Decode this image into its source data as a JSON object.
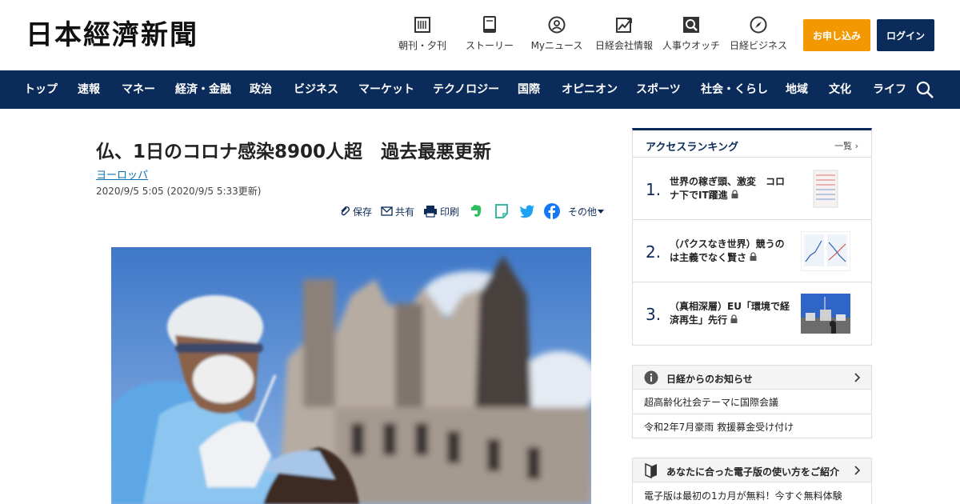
{
  "header": {
    "logo": "日本經濟新聞",
    "utility": [
      {
        "label": "朝刊・夕刊",
        "icon": "newspaper-icon"
      },
      {
        "label": "ストーリー",
        "icon": "book-icon"
      },
      {
        "label": "Myニュース",
        "icon": "person-icon"
      },
      {
        "label": "日経会社情報",
        "icon": "chart-icon"
      },
      {
        "label": "人事ウオッチ",
        "icon": "magnifier-icon"
      },
      {
        "label": "日経ビジネス",
        "icon": "compass-icon"
      }
    ],
    "apply_label": "お申し込み",
    "login_label": "ログイン"
  },
  "nav": {
    "items": [
      "トップ",
      "速報",
      "マネー",
      "経済・金融",
      "政治",
      "ビジネス",
      "マーケット",
      "テクノロジー",
      "国際",
      "オピニオン",
      "スポーツ",
      "社会・くらし",
      "地域",
      "文化",
      "ライフ"
    ]
  },
  "article": {
    "title": "仏、1日のコロナ感染8900人超　過去最悪更新",
    "category": "ヨーロッパ",
    "date": "2020/9/5 5:05 (2020/9/5 5:33更新)",
    "share": {
      "save": "保存",
      "share": "共有",
      "print": "印刷",
      "other": "その他"
    }
  },
  "ranking": {
    "title": "アクセスランキング",
    "more": "一覧",
    "items": [
      {
        "num": "1.",
        "text": "世界の稼ぎ頭、激変　コロナ下でIT躍進"
      },
      {
        "num": "2.",
        "text": "（パクスなき世界）競うのは主義でなく賢さ"
      },
      {
        "num": "3.",
        "text": "（真相深層）EU「環境で経済再生」先行"
      }
    ]
  },
  "notice": {
    "title": "日経からのお知らせ",
    "links": [
      "超高齢化社会テーマに国際会議",
      "令和2年7月豪雨 救援募金受け付け"
    ]
  },
  "guide": {
    "title": "あなたに合った電子版の使い方をご紹介",
    "text": "電子版は最初の1カ月が無料！今すぐ無料体験"
  },
  "colors": {
    "navy": "#0b2b5a",
    "orange": "#f39800",
    "link": "#0b6fb8"
  }
}
